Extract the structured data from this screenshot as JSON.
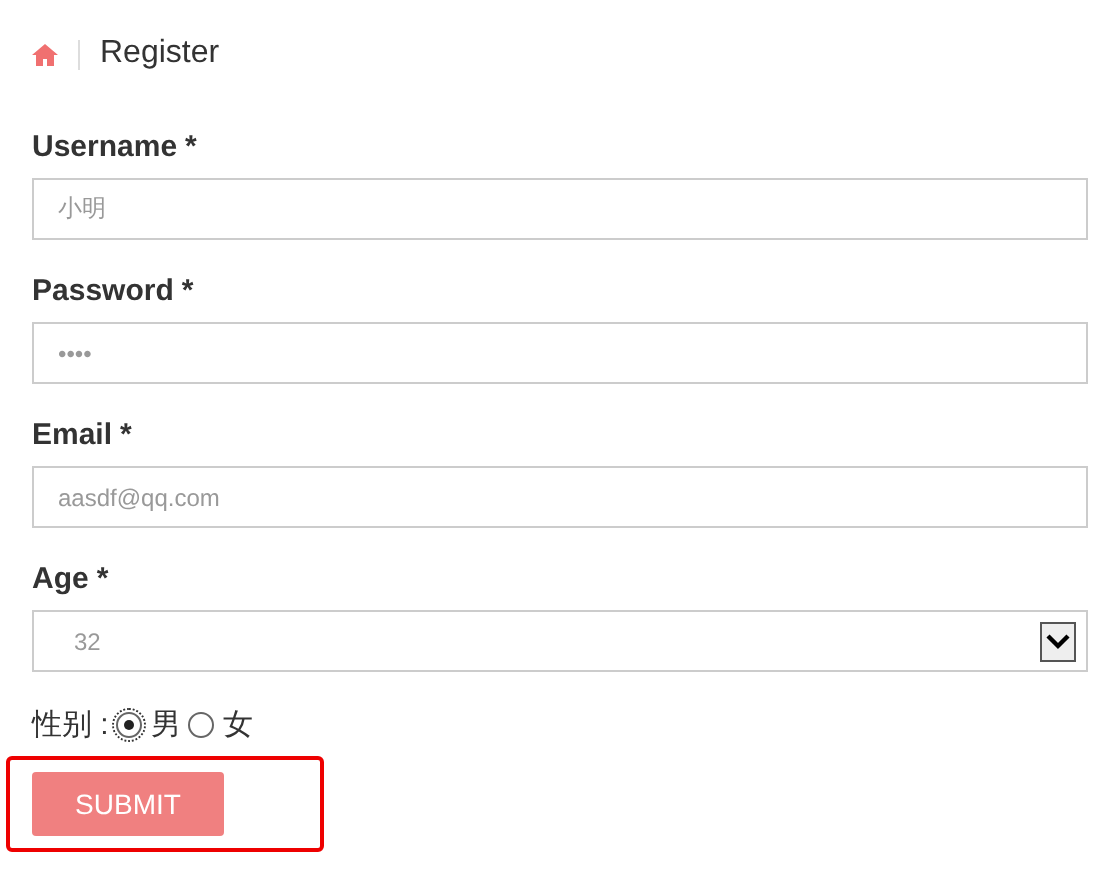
{
  "breadcrumb": {
    "title": "Register"
  },
  "fields": [
    {
      "kind": "text",
      "label": "Username",
      "required_mark": "*",
      "value": "小明"
    },
    {
      "kind": "text",
      "label": "Password",
      "required_mark": "*",
      "value": "••••"
    },
    {
      "kind": "text",
      "label": "Email",
      "required_mark": "*",
      "value": "aasdf@qq.com"
    },
    {
      "kind": "select",
      "label": "Age",
      "required_mark": "*",
      "value": "32"
    }
  ],
  "gender": {
    "label": "性别 :",
    "options": [
      {
        "label": "男",
        "selected": true
      },
      {
        "label": "女",
        "selected": false
      }
    ]
  },
  "submit": {
    "label": "SUBMIT",
    "highlighted": true
  }
}
